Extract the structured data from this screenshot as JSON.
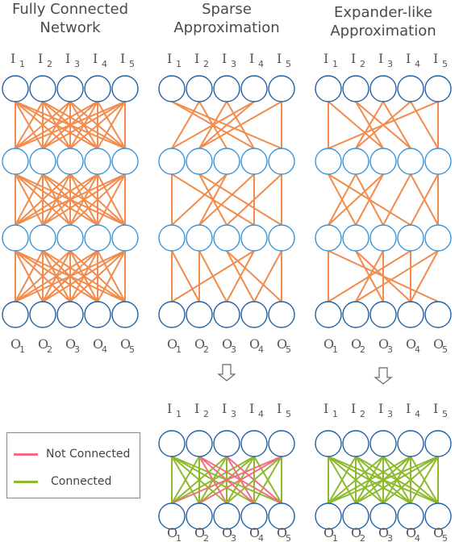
{
  "titles": [
    {
      "line1": "Fully Connected",
      "line2": "Network"
    },
    {
      "line1": "Sparse",
      "line2": "Approximation"
    },
    {
      "line1": "Expander-like",
      "line2": "Approximation"
    }
  ],
  "input_labels": [
    "I",
    "I",
    "I",
    "I",
    "I"
  ],
  "output_labels": [
    "O",
    "O",
    "O",
    "O",
    "O"
  ],
  "subscripts": [
    "1",
    "2",
    "3",
    "4",
    "5"
  ],
  "legend": {
    "not_connected": {
      "label": "Not Connected",
      "color": "#ef6f7f"
    },
    "connected": {
      "label": "Connected",
      "color": "#8dba2c"
    }
  },
  "colors": {
    "edge": "#f28b4b",
    "node_outer": "#1f5fa6",
    "node_hidden": "#3a93d6",
    "arrow": "#666666"
  },
  "networks": {
    "fully_connected": {
      "layers": 4,
      "edges": "all"
    },
    "sparse": {
      "layers": 4,
      "edges": [
        [
          [
            0,
            3
          ],
          [
            0,
            4
          ],
          [
            1,
            0
          ],
          [
            1,
            2
          ],
          [
            2,
            1
          ],
          [
            2,
            3
          ],
          [
            3,
            0
          ],
          [
            3,
            1
          ],
          [
            4,
            1
          ],
          [
            4,
            4
          ]
        ],
        [
          [
            0,
            0
          ],
          [
            1,
            2
          ],
          [
            1,
            4
          ],
          [
            2,
            0
          ],
          [
            2,
            1
          ],
          [
            3,
            1
          ],
          [
            3,
            3
          ],
          [
            4,
            2
          ],
          [
            0,
            3
          ],
          [
            4,
            4
          ]
        ],
        [
          [
            0,
            0
          ],
          [
            0,
            1
          ],
          [
            1,
            1
          ],
          [
            1,
            2
          ],
          [
            2,
            3
          ],
          [
            2,
            4
          ],
          [
            3,
            0
          ],
          [
            3,
            2
          ],
          [
            4,
            3
          ],
          [
            4,
            4
          ]
        ]
      ]
    },
    "expander": {
      "layers": 4,
      "edges": [
        [
          [
            0,
            0
          ],
          [
            0,
            2
          ],
          [
            1,
            2
          ],
          [
            1,
            3
          ],
          [
            2,
            1
          ],
          [
            2,
            3
          ],
          [
            3,
            1
          ],
          [
            3,
            4
          ],
          [
            4,
            0
          ],
          [
            4,
            4
          ]
        ],
        [
          [
            0,
            1
          ],
          [
            0,
            3
          ],
          [
            1,
            0
          ],
          [
            1,
            2
          ],
          [
            2,
            0
          ],
          [
            2,
            1
          ],
          [
            3,
            2
          ],
          [
            3,
            4
          ],
          [
            4,
            3
          ],
          [
            4,
            4
          ]
        ],
        [
          [
            0,
            0
          ],
          [
            0,
            4
          ],
          [
            1,
            2
          ],
          [
            1,
            3
          ],
          [
            2,
            1
          ],
          [
            2,
            2
          ],
          [
            3,
            0
          ],
          [
            3,
            3
          ],
          [
            4,
            1
          ],
          [
            4,
            3
          ]
        ]
      ]
    },
    "sparse_collapsed": {
      "not_connected": [
        [
          1,
          3
        ],
        [
          1,
          4
        ],
        [
          2,
          3
        ],
        [
          2,
          4
        ],
        [
          4,
          0
        ],
        [
          4,
          1
        ],
        [
          1,
          2
        ]
      ],
      "connected": "rest"
    },
    "expander_collapsed": {
      "not_connected": [],
      "connected": "all"
    }
  }
}
